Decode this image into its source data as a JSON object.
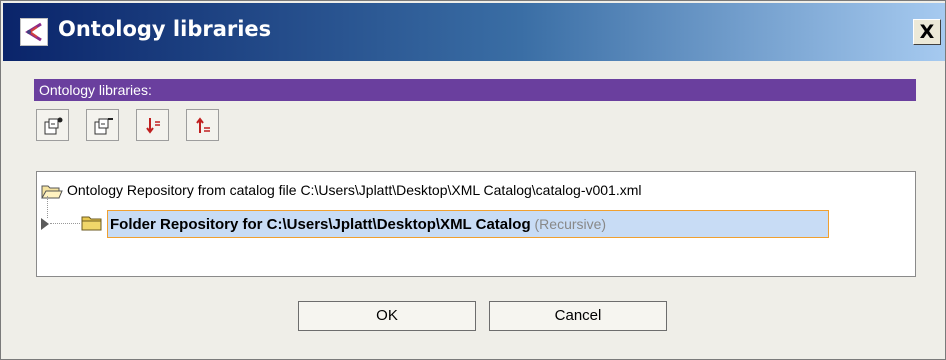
{
  "window": {
    "title": "Ontology libraries",
    "close_label": "X"
  },
  "panel": {
    "header": "Ontology libraries:"
  },
  "toolbar": {
    "buttons": [
      {
        "icon": "add-library-icon"
      },
      {
        "icon": "remove-library-icon"
      },
      {
        "icon": "move-down-icon"
      },
      {
        "icon": "move-up-icon"
      }
    ]
  },
  "tree": {
    "items": [
      {
        "label": "Ontology Repository from catalog file C:\\Users\\Jplatt\\Desktop\\XML Catalog\\catalog-v001.xml",
        "icon": "open-folder-icon"
      },
      {
        "label": "Folder Repository for C:\\Users\\Jplatt\\Desktop\\XML Catalog",
        "tag": "(Recursive)",
        "icon": "folder-icon",
        "selected": true
      }
    ]
  },
  "buttons": {
    "ok_label": "OK",
    "cancel_label": "Cancel"
  },
  "colors": {
    "header_bg": "#6a3f9e",
    "selection_bg": "#c8dcf5",
    "selection_border": "#f0a030",
    "titlebar_start": "#0a246a"
  }
}
